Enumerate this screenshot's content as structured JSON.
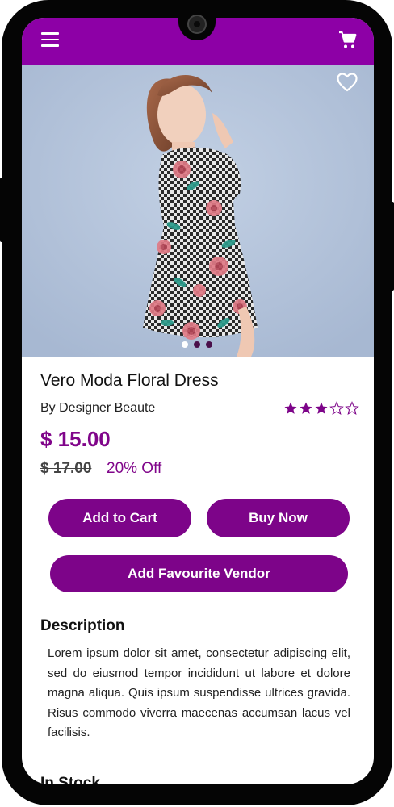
{
  "appbar": {
    "menu_icon": "hamburger-menu-icon",
    "cart_icon": "shopping-cart-icon",
    "color": "#8d00a6"
  },
  "product": {
    "image_icon": "product-photo",
    "favorite_icon": "heart-outline-icon",
    "carousel": {
      "count": 3,
      "active_index": 0
    },
    "name": "Vero Moda Floral Dress",
    "brand": "By Designer Beaute",
    "rating": {
      "value": 3,
      "max": 5
    },
    "price": "$ 15.00",
    "old_price": "$ 17.00",
    "discount": "20% Off"
  },
  "actions": {
    "add_to_cart": "Add to Cart",
    "buy_now": "Buy Now",
    "add_favourite_vendor": "Add Favourite Vendor"
  },
  "description": {
    "heading": "Description",
    "text": "Lorem ipsum dolor sit amet, consectetur adipiscing elit, sed do eiusmod tempor incididunt ut labore et dolore magna aliqua. Quis ipsum suspendisse ultrices gravida. Risus commodo viverra maecenas accumsan lacus vel facilisis."
  },
  "stock": {
    "label": "In Stock"
  },
  "colors": {
    "accent": "#7d0489",
    "price": "#80058a",
    "hero_bg": "#b0c0d8"
  }
}
